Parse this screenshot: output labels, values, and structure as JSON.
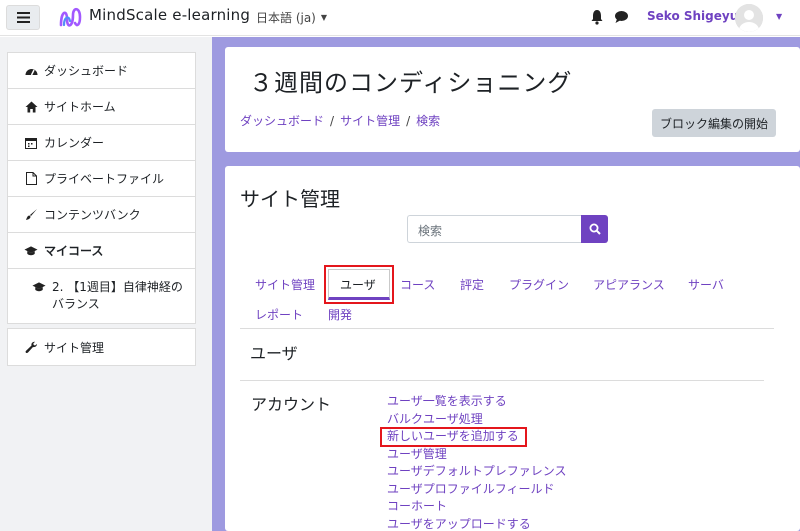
{
  "navbar": {
    "brand": "MindScale e-learning",
    "language": "日本語 (ja)",
    "username": "Seko Shigeyuki",
    "icons": [
      "menu-icon",
      "logo-icon",
      "bell-icon",
      "chat-icon",
      "avatar"
    ]
  },
  "drawer": {
    "items": [
      {
        "label": "ダッシュボード",
        "icon": "dashboard-icon"
      },
      {
        "label": "サイトホーム",
        "icon": "home-icon"
      },
      {
        "label": "カレンダー",
        "icon": "calendar-icon"
      },
      {
        "label": "プライベートファイル",
        "icon": "file-icon"
      },
      {
        "label": "コンテンツバンク",
        "icon": "brush-icon"
      },
      {
        "label": "マイコース",
        "icon": "graduation-cap-icon"
      },
      {
        "label": "2. 【1週目】自律神経の\nバランス",
        "icon": "graduation-cap-icon"
      }
    ],
    "admin": {
      "label": "サイト管理",
      "icon": "wrench-icon"
    }
  },
  "header": {
    "title": "３週間のコンディショニング",
    "breadcrumb": [
      "ダッシュボード",
      "サイト管理",
      "検索"
    ],
    "block_edit_button": "ブロック編集の開始"
  },
  "main": {
    "section_title": "サイト管理",
    "search_placeholder": "検索",
    "tabs": [
      "サイト管理",
      "ユーザ",
      "コース",
      "評定",
      "プラグイン",
      "アピアランス",
      "サーバ",
      "レポート",
      "開発"
    ],
    "active_tab": "ユーザ",
    "sub_title": "ユーザ",
    "account_label": "アカウント",
    "account_links": [
      "ユーザ一覧を表示する",
      "バルクユーザ処理",
      "新しいユーザを追加する",
      "ユーザ管理",
      "ユーザデフォルトプレファレンス",
      "ユーザプロファイルフィールド",
      "コーホート",
      "ユーザをアップロードする"
    ],
    "highlighted_link": "新しいユーザを追加する"
  },
  "colors": {
    "accent": "#6f42c1",
    "highlight": "#e4161c",
    "page_bg": "#9e9ae0"
  }
}
